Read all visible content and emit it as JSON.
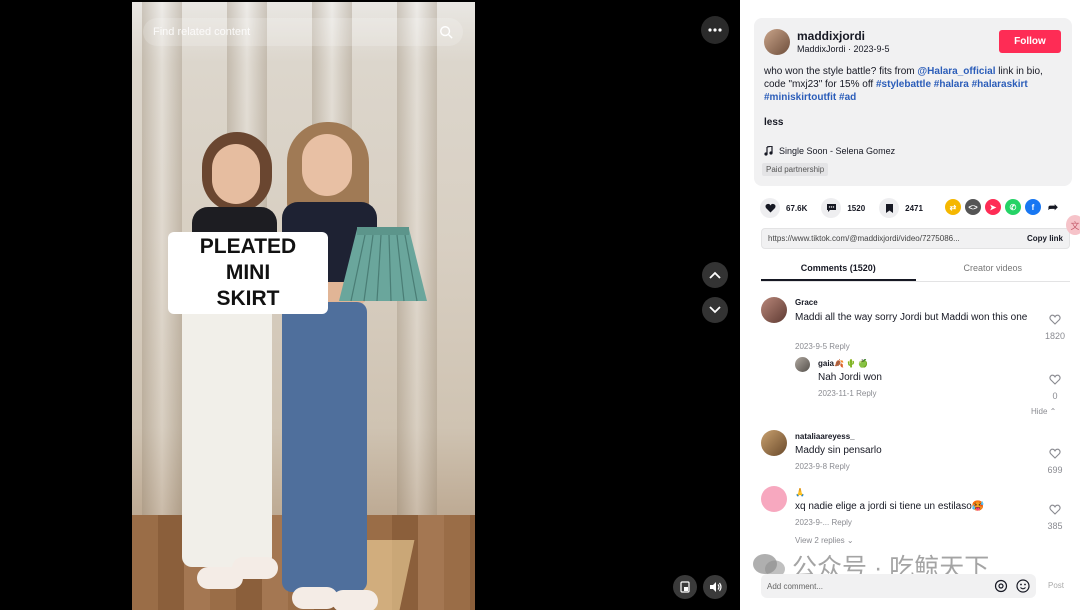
{
  "video": {
    "search_placeholder": "Find related content",
    "caption_line1": "PLEATED MINI",
    "caption_line2": "SKIRT"
  },
  "author": {
    "username": "maddixjordi",
    "subline": "MaddixJordi · 2023-9-5",
    "follow_label": "Follow"
  },
  "description": {
    "text_1": "who won the style battle? fits from ",
    "mention": "@Halara_official",
    "text_2": " link in bio, code \"mxj23\" for 15% off ",
    "hashtags": "#stylebattle #halara #halaraskirt #miniskirtoutfit #ad",
    "less_label": "less",
    "music": "Single Soon - Selena Gomez",
    "paid_label": "Paid partnership"
  },
  "stats": {
    "likes": "67.6K",
    "comments": "1520",
    "saves": "2471"
  },
  "share": {
    "url": "https://www.tiktok.com/@maddixjordi/video/7275086...",
    "copy_label": "Copy link"
  },
  "tabs": [
    {
      "label": "Comments (1520)"
    },
    {
      "label": "Creator videos"
    }
  ],
  "comments": [
    {
      "name": "Grace",
      "text": "Maddi all the way sorry Jordi but Maddi won this one",
      "meta": "2023-9-5  Reply",
      "likes": "1820"
    },
    {
      "name": "gaia🍂 🌵 🍏",
      "text": "Nah Jordi won",
      "meta": "2023-11-1  Reply",
      "likes": "0",
      "hide_label": "Hide ⌃"
    },
    {
      "name": "nataliaareyess_",
      "text": "Maddy sin pensarlo",
      "meta": "2023-9-8  Reply",
      "likes": "699"
    },
    {
      "name": "🙏",
      "text": "xq nadie elige a jordi si tiene un estilaso🥵",
      "meta": "2023-9-...  Reply",
      "likes": "385",
      "view_replies": "View 2 replies ⌄"
    }
  ],
  "comment_input": {
    "placeholder": "Add comment...",
    "post_label": "Post"
  },
  "watermark": "公众号 · 吃鲸天下",
  "colors": {
    "accent": "#fe2c55",
    "link": "#2b5db9"
  }
}
